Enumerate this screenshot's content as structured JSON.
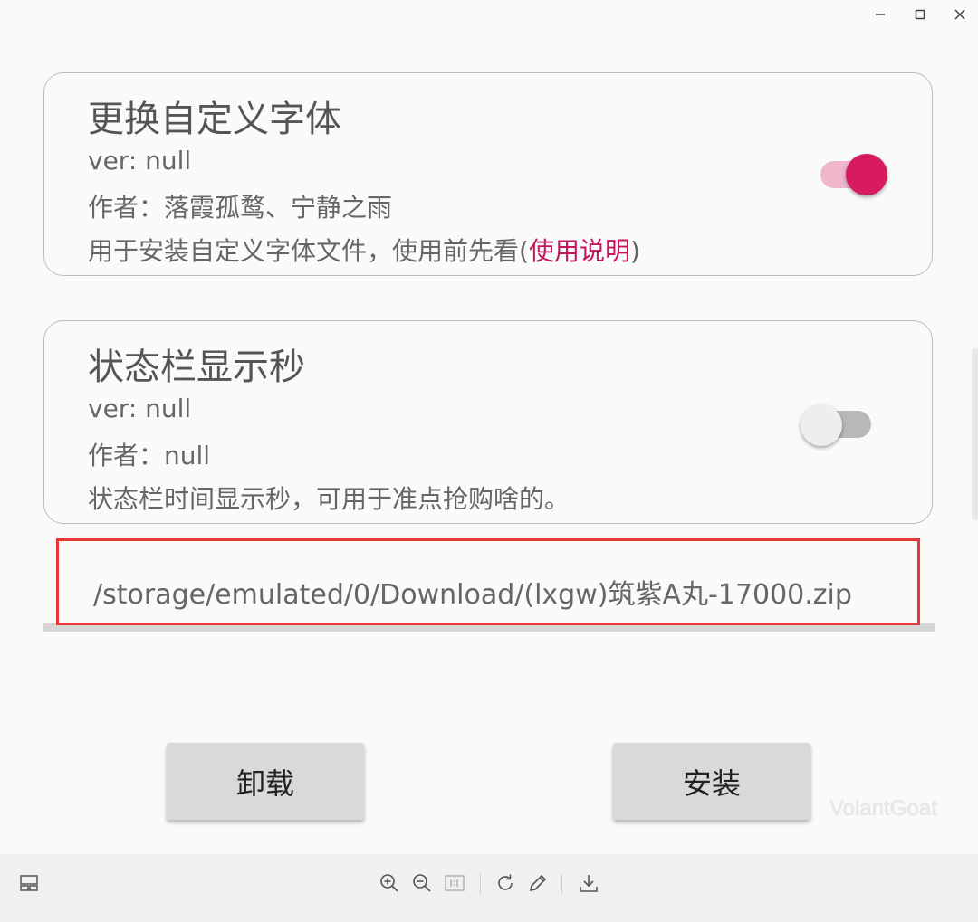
{
  "card1": {
    "title": "更换自定义字体",
    "ver": "ver: null",
    "author": "作者：落霞孤鹜、宁静之雨",
    "desc_prefix": "用于安装自定义字体文件，使用前先看(",
    "desc_link": "使用说明",
    "desc_suffix": ")",
    "enabled": true
  },
  "card2": {
    "title": "状态栏显示秒",
    "ver": "ver: null",
    "author": "作者：null",
    "desc": "状态栏时间显示秒，可用于准点抢购啥的。",
    "enabled": false
  },
  "file_path": "/storage/emulated/0/Download/(lxgw)筑紫A丸-17000.zip",
  "buttons": {
    "uninstall": "卸载",
    "install": "安装"
  },
  "watermark": "VolantGoat",
  "toolbar": {
    "icons": [
      "layout-icon",
      "zoom-in-icon",
      "zoom-out-icon",
      "actual-size-icon",
      "rotate-icon",
      "edit-icon",
      "download-icon"
    ]
  },
  "colors": {
    "accent": "#d81b60",
    "link": "#c2185b",
    "highlight": "#e53935"
  }
}
